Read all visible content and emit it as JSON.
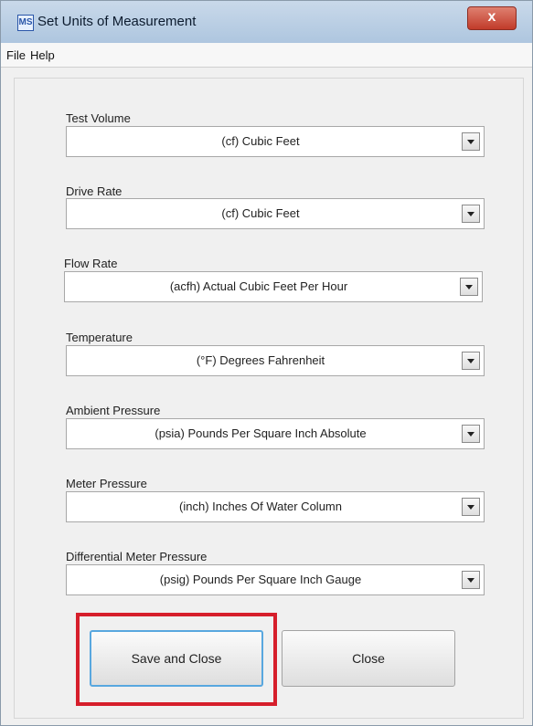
{
  "window": {
    "title": "Set Units of Measurement",
    "app_icon_text": "MS",
    "close_glyph": "x"
  },
  "menu": {
    "file": "File",
    "help": "Help"
  },
  "fields": [
    {
      "label": "Test Volume",
      "value": "(cf) Cubic Feet"
    },
    {
      "label": "Drive Rate",
      "value": "(cf) Cubic Feet"
    },
    {
      "label": "Flow Rate",
      "value": "(acfh) Actual Cubic Feet Per Hour"
    },
    {
      "label": "Temperature",
      "value": "(°F) Degrees Fahrenheit"
    },
    {
      "label": "Ambient Pressure",
      "value": "(psia) Pounds Per Square Inch  Absolute"
    },
    {
      "label": "Meter Pressure",
      "value": "(inch) Inches Of Water Column"
    },
    {
      "label": "Differential Meter Pressure",
      "value": "(psig) Pounds Per Square Inch  Gauge"
    }
  ],
  "buttons": {
    "save": "Save and Close",
    "close": "Close"
  },
  "colors": {
    "highlight": "#d61e2b",
    "focus_border": "#58a7df"
  }
}
